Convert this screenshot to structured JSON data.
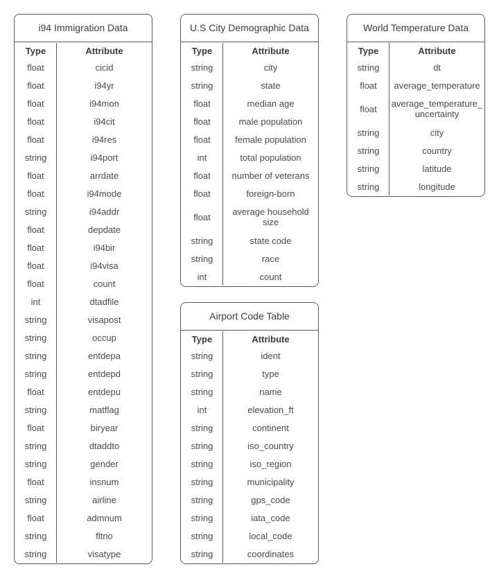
{
  "headers": {
    "type": "Type",
    "attribute": "Attribute"
  },
  "tables": {
    "immigration": {
      "title": "i94 Immigration Data",
      "rows": [
        [
          "float",
          "cicid"
        ],
        [
          "float",
          "i94yr"
        ],
        [
          "float",
          "i94mon"
        ],
        [
          "float",
          "i94cit"
        ],
        [
          "float",
          "i94res"
        ],
        [
          "string",
          "i94port"
        ],
        [
          "float",
          "arrdate"
        ],
        [
          "float",
          "i94mode"
        ],
        [
          "string",
          "i94addr"
        ],
        [
          "float",
          "depdate"
        ],
        [
          "float",
          "i94bir"
        ],
        [
          "float",
          "i94visa"
        ],
        [
          "float",
          "count"
        ],
        [
          "int",
          "dtadfile"
        ],
        [
          "string",
          "visapost"
        ],
        [
          "string",
          "occup"
        ],
        [
          "string",
          "entdepa"
        ],
        [
          "string",
          "entdepd"
        ],
        [
          "float",
          "entdepu"
        ],
        [
          "string",
          "matflag"
        ],
        [
          "float",
          "biryear"
        ],
        [
          "string",
          "dtaddto"
        ],
        [
          "string",
          "gender"
        ],
        [
          "float",
          "insnum"
        ],
        [
          "string",
          "airline"
        ],
        [
          "float",
          "admnum"
        ],
        [
          "string",
          "fltno"
        ],
        [
          "string",
          "visatype"
        ]
      ]
    },
    "demographic": {
      "title": "U.S City Demographic Data",
      "rows": [
        [
          "string",
          "city"
        ],
        [
          "string",
          "state"
        ],
        [
          "float",
          "median age"
        ],
        [
          "float",
          "male population"
        ],
        [
          "float",
          "female population"
        ],
        [
          "int",
          "total population"
        ],
        [
          "float",
          "number of veterans"
        ],
        [
          "float",
          "foreign-born"
        ],
        [
          "float",
          "average household size"
        ],
        [
          "string",
          "state code"
        ],
        [
          "string",
          "race"
        ],
        [
          "int",
          "count"
        ]
      ]
    },
    "airport": {
      "title": "Airport Code Table",
      "rows": [
        [
          "string",
          "ident"
        ],
        [
          "string",
          "type"
        ],
        [
          "string",
          "name"
        ],
        [
          "int",
          "elevation_ft"
        ],
        [
          "string",
          "continent"
        ],
        [
          "string",
          "iso_country"
        ],
        [
          "string",
          "iso_region"
        ],
        [
          "string",
          "municipality"
        ],
        [
          "string",
          "gps_code"
        ],
        [
          "string",
          "iata_code"
        ],
        [
          "string",
          "local_code"
        ],
        [
          "string",
          "coordinates"
        ]
      ]
    },
    "temperature": {
      "title": "World Temperature Data",
      "rows": [
        [
          "string",
          "dt"
        ],
        [
          "float",
          "average_temperature"
        ],
        [
          "float",
          "average_temperature_ uncertainty"
        ],
        [
          "string",
          "city"
        ],
        [
          "string",
          "country"
        ],
        [
          "string",
          "latitude"
        ],
        [
          "string",
          "longitude"
        ]
      ]
    }
  }
}
